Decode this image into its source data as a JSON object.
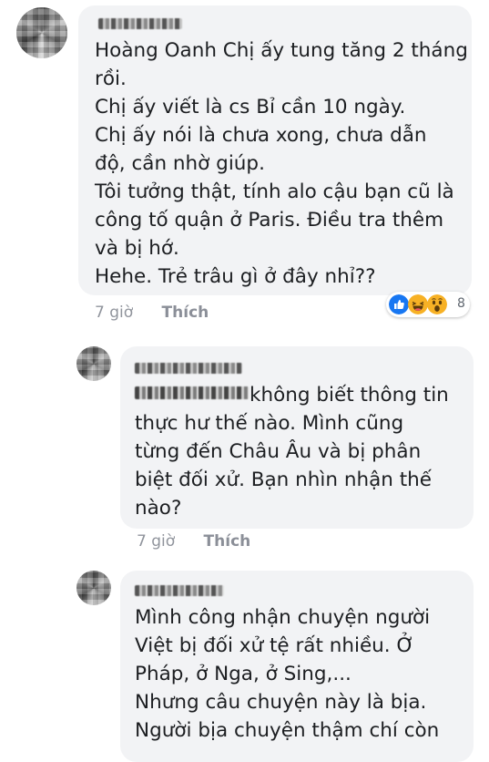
{
  "comments": [
    {
      "lines": [
        "Hoàng Oanh Chị ấy tung tăng 2 tháng",
        "rồi.",
        "Chị ấy viết là cs Bỉ cần 10 ngày.",
        "Chị ấy nói là chưa xong, chưa dẫn",
        "độ, cần nhờ giúp.",
        "Tôi tưởng thật, tính alo cậu bạn cũ là",
        "công tố quận ở Paris. Điều tra thêm",
        "và bị hớ.",
        "Hehe. Trẻ trâu gì ở đây nhỉ??"
      ],
      "time": "7 giờ",
      "like": "Thích",
      "reactions": {
        "icons": [
          "like-reaction-icon",
          "haha-reaction-icon",
          "wow-reaction-icon"
        ],
        "colors": [
          "#1877f2",
          "#f7b125",
          "#f7b125"
        ],
        "count": "8"
      }
    },
    {
      "first_line_rest": "không biết thông tin",
      "lines": [
        "thực hư thế nào. Mình cũng",
        "từng đến Châu Âu và bị phân",
        "biệt đối xử. Bạn nhìn nhận thế",
        "nào?"
      ],
      "time": "7 giờ",
      "like": "Thích"
    },
    {
      "lines": [
        "Mình công nhận chuyện người",
        "Việt bị đối xử tệ rất nhiều. Ở",
        "Pháp, ở Nga, ở Sing,...",
        "Nhưng câu chuyện này là bịa.",
        "Người bịa chuyện thậm chí còn"
      ]
    }
  ]
}
